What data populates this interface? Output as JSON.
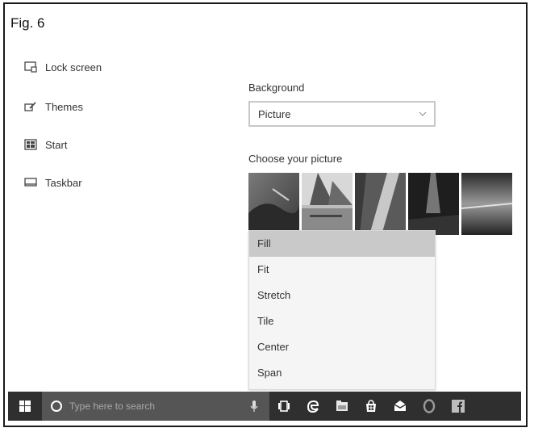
{
  "figure": {
    "label": "Fig. 6"
  },
  "sidebar": {
    "items": [
      {
        "label": "Lock screen",
        "icon": "lock-screen-icon"
      },
      {
        "label": "Themes",
        "icon": "themes-icon"
      },
      {
        "label": "Start",
        "icon": "start-icon"
      },
      {
        "label": "Taskbar",
        "icon": "taskbar-icon"
      }
    ]
  },
  "background": {
    "label": "Background",
    "selected": "Picture"
  },
  "picture": {
    "label": "Choose your picture",
    "thumbnails": [
      "picture-thumbnail-1",
      "picture-thumbnail-2",
      "picture-thumbnail-3",
      "picture-thumbnail-4",
      "picture-thumbnail-5"
    ]
  },
  "fit_dropdown": {
    "options": [
      "Fill",
      "Fit",
      "Stretch",
      "Tile",
      "Center",
      "Span"
    ],
    "highlighted": "Fill"
  },
  "taskbar": {
    "search_placeholder": "Type here to search",
    "icons": [
      "windows-start-icon",
      "cortana-icon",
      "microphone-icon",
      "task-view-icon",
      "edge-icon",
      "file-explorer-icon",
      "store-icon",
      "mail-icon",
      "opera-icon",
      "facebook-icon"
    ]
  },
  "colors": {
    "taskbar": "#2f2f2f",
    "searchbox": "#555555",
    "dropdown_highlight": "#c9c9c9"
  }
}
